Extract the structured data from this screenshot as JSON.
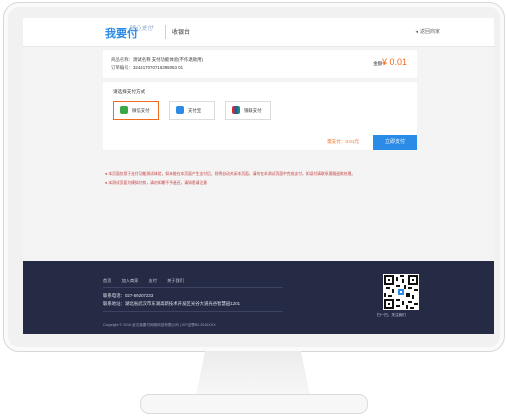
{
  "header": {
    "logo": "我要付",
    "logo_script": "随心支付",
    "cashier": "收银台",
    "back_label": "返回商家"
  },
  "order": {
    "merchant_label": "商品名称：",
    "merchant_value": "测试名称 支付功能体验(不作退款用)",
    "order_no_label": "订单编号：",
    "order_no_value": "324417070716395063 01",
    "amount_label": "金额：",
    "amount_value": "¥ 0.01"
  },
  "payment": {
    "title": "请选择支付方式",
    "methods": [
      {
        "label": "微信支付",
        "icon": "wechat-icon"
      },
      {
        "label": "支付宝",
        "icon": "alipay-icon"
      },
      {
        "label": "银联支付",
        "icon": "unionpay-icon"
      }
    ],
    "should_pay": "需支付：0.01元",
    "pay_button": "立即支付"
  },
  "notes": [
    "● 本页面仅用于支付功能测试体验，如未能在本页面产生支付后，则将自动关闭本页面，请勿在本测试页面中完成支付，如误付请联系客服退款处理。",
    "● 本测试页面为模拟付款，请勿如期不予退还，请知悉请注意"
  ],
  "footer": {
    "links": [
      "首页",
      "加入商家",
      "支付",
      "关于我们"
    ],
    "contact_phone": "联系电话：027-59207233",
    "contact_address": "联系地址：湖北省武汉市东湖高新技术开发区光谷大道光谷智慧园1201",
    "copyright": "Copyright © 2016 武汉我要付网络科技有限公司  |  ICP证鄂B2-2016XXX",
    "qr_caption": "扫一扫，关注我们"
  },
  "colors": {
    "accent": "#2b8be6",
    "price": "#f36b1c",
    "footer_bg": "#252a45"
  }
}
